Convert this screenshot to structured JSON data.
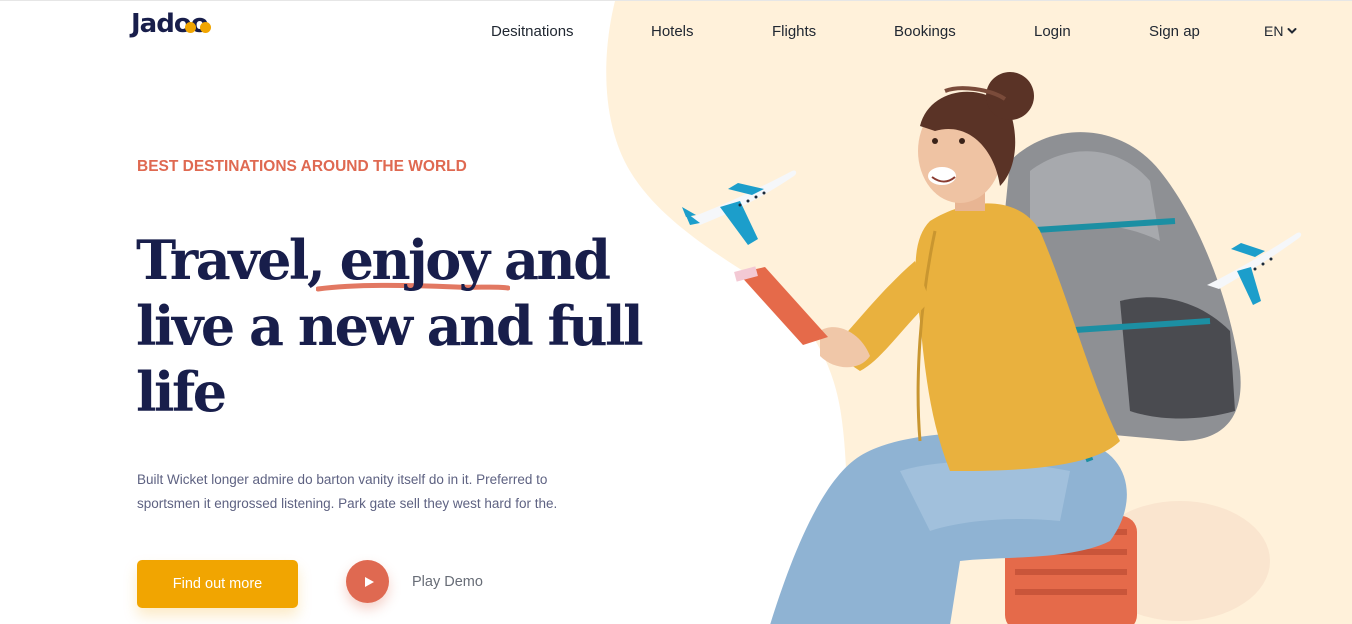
{
  "brand": {
    "name_prefix": "Jad",
    "name_suffix": "oo",
    "accent_color": "#f1a501"
  },
  "nav": {
    "items": [
      {
        "label": "Desitnations"
      },
      {
        "label": "Hotels"
      },
      {
        "label": "Flights"
      },
      {
        "label": "Bookings"
      },
      {
        "label": "Login"
      },
      {
        "label": "Sign ap"
      }
    ],
    "language": "EN",
    "language_icon": "chevron-down-icon"
  },
  "hero": {
    "eyebrow": "BEST DESTINATIONS AROUND THE WORLD",
    "headline": {
      "line1_a": "Travel,",
      "line1_b": "enjoy",
      "line1_c": "and",
      "line2": "live a new and full",
      "line3": "life"
    },
    "description_line1": "Built Wicket longer admire do barton vanity itself do in it. Preferred to",
    "description_line2": "sportsmen it engrossed listening. Park gate sell they west hard for the.",
    "cta_label": "Find out more",
    "play_label": "Play Demo",
    "play_icon": "play-icon"
  },
  "colors": {
    "headline": "#181e4b",
    "eyebrow": "#df6951",
    "cta": "#f1a501",
    "play": "#df6951",
    "blob": "#fff1da",
    "plane": "#1c9ecb"
  }
}
